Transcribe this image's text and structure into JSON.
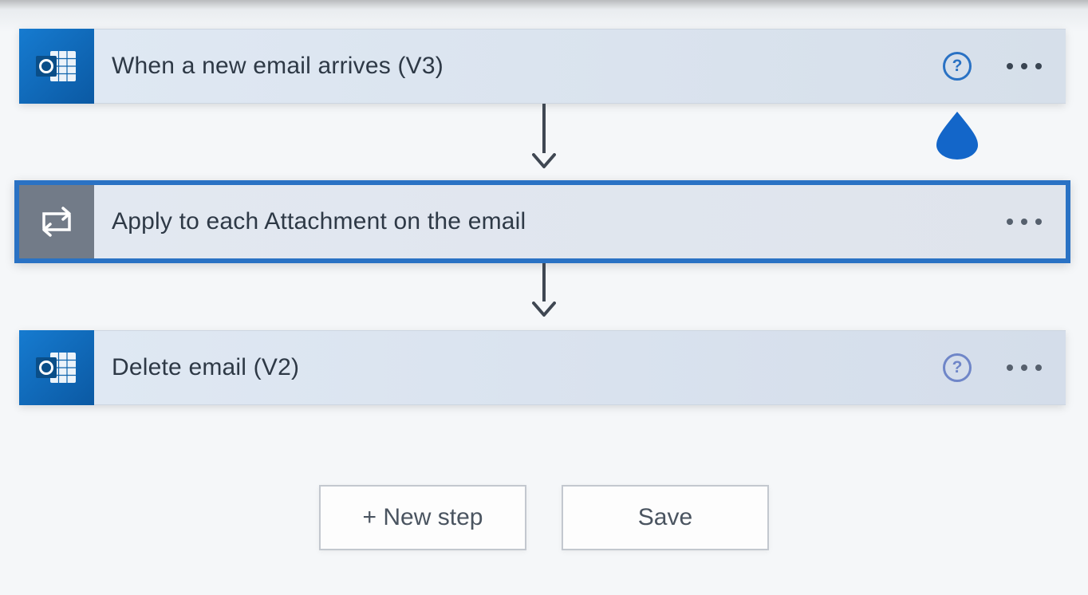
{
  "steps": [
    {
      "id": "trigger",
      "title": "When a new email arrives (V3)",
      "connector": "Office 365 Outlook",
      "icon": "outlook-icon",
      "selected": false,
      "help": true
    },
    {
      "id": "apply-to-each",
      "title": "Apply to each Attachment on the email",
      "connector": "Control",
      "icon": "apply-to-each-icon",
      "selected": true,
      "help": false
    },
    {
      "id": "delete-email",
      "title": "Delete email (V2)",
      "connector": "Office 365 Outlook",
      "icon": "outlook-icon",
      "selected": false,
      "help": true
    }
  ],
  "buttons": {
    "new_step": "+ New step",
    "save": "Save"
  },
  "colors": {
    "outlook_blue": "#0f64ad",
    "control_gray": "#727b88",
    "selection": "#2a72c4",
    "cursor": "#1366c9"
  }
}
